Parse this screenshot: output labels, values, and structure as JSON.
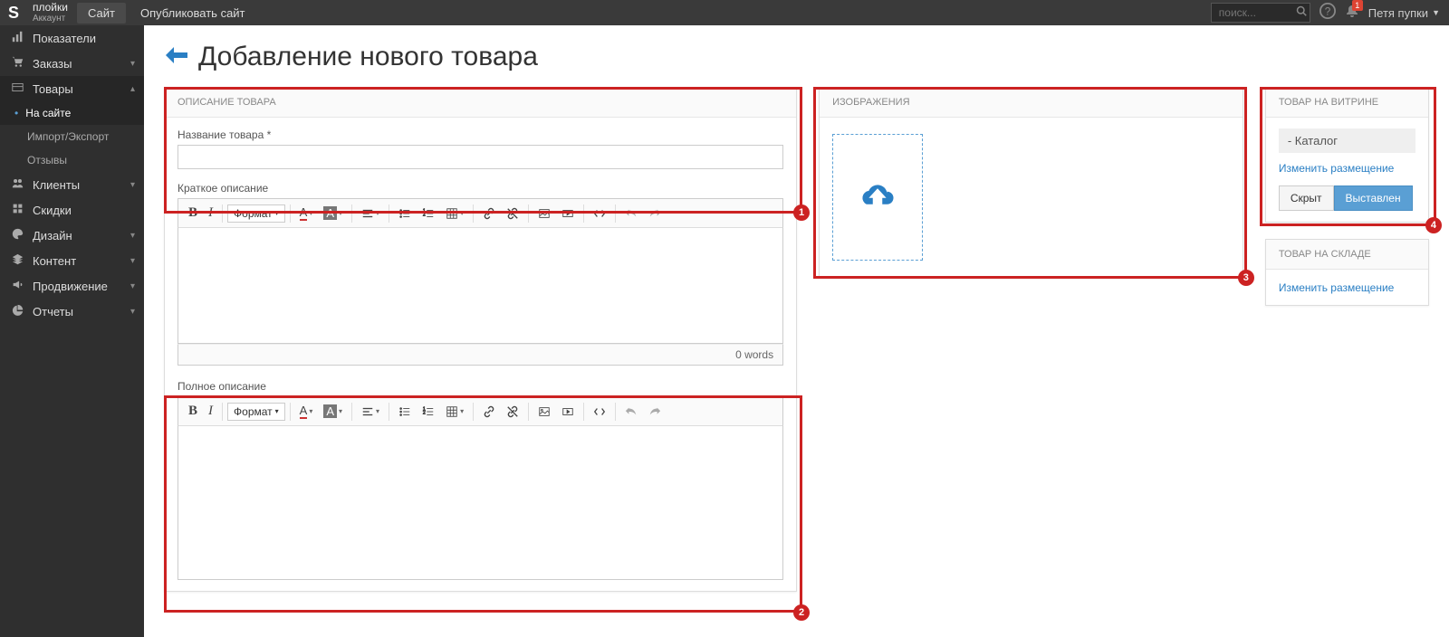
{
  "topbar": {
    "brand_name": "плойки",
    "brand_sub": "Аккаунт",
    "site_btn": "Сайт",
    "publish_btn": "Опубликовать сайт",
    "search_placeholder": "поиск...",
    "bell_count": "1",
    "user_name": "Петя пупки"
  },
  "sidebar": {
    "indicators": "Показатели",
    "orders": "Заказы",
    "products": "Товары",
    "on_site": "На сайте",
    "import_export": "Импорт/Экспорт",
    "reviews": "Отзывы",
    "clients": "Клиенты",
    "discounts": "Скидки",
    "design": "Дизайн",
    "content": "Контент",
    "promotion": "Продвижение",
    "reports": "Отчеты"
  },
  "page": {
    "title": "Добавление нового товара"
  },
  "desc_panel": {
    "header": "ОПИСАНИЕ ТОВАРА",
    "name_label": "Название товара *",
    "short_label": "Краткое описание",
    "full_label": "Полное описание",
    "format_label": "Формат",
    "words": "0 words"
  },
  "images_panel": {
    "header": "ИЗОБРАЖЕНИЯ"
  },
  "showcase_panel": {
    "header": "ТОВАР НА ВИТРИНЕ",
    "catalog": "Каталог",
    "change_link": "Изменить размещение",
    "hidden_btn": "Скрыт",
    "shown_btn": "Выставлен"
  },
  "stock_panel": {
    "header": "ТОВАР НА СКЛАДЕ",
    "change_link": "Изменить размещение"
  },
  "callouts": {
    "c1": "1",
    "c2": "2",
    "c3": "3",
    "c4": "4"
  }
}
